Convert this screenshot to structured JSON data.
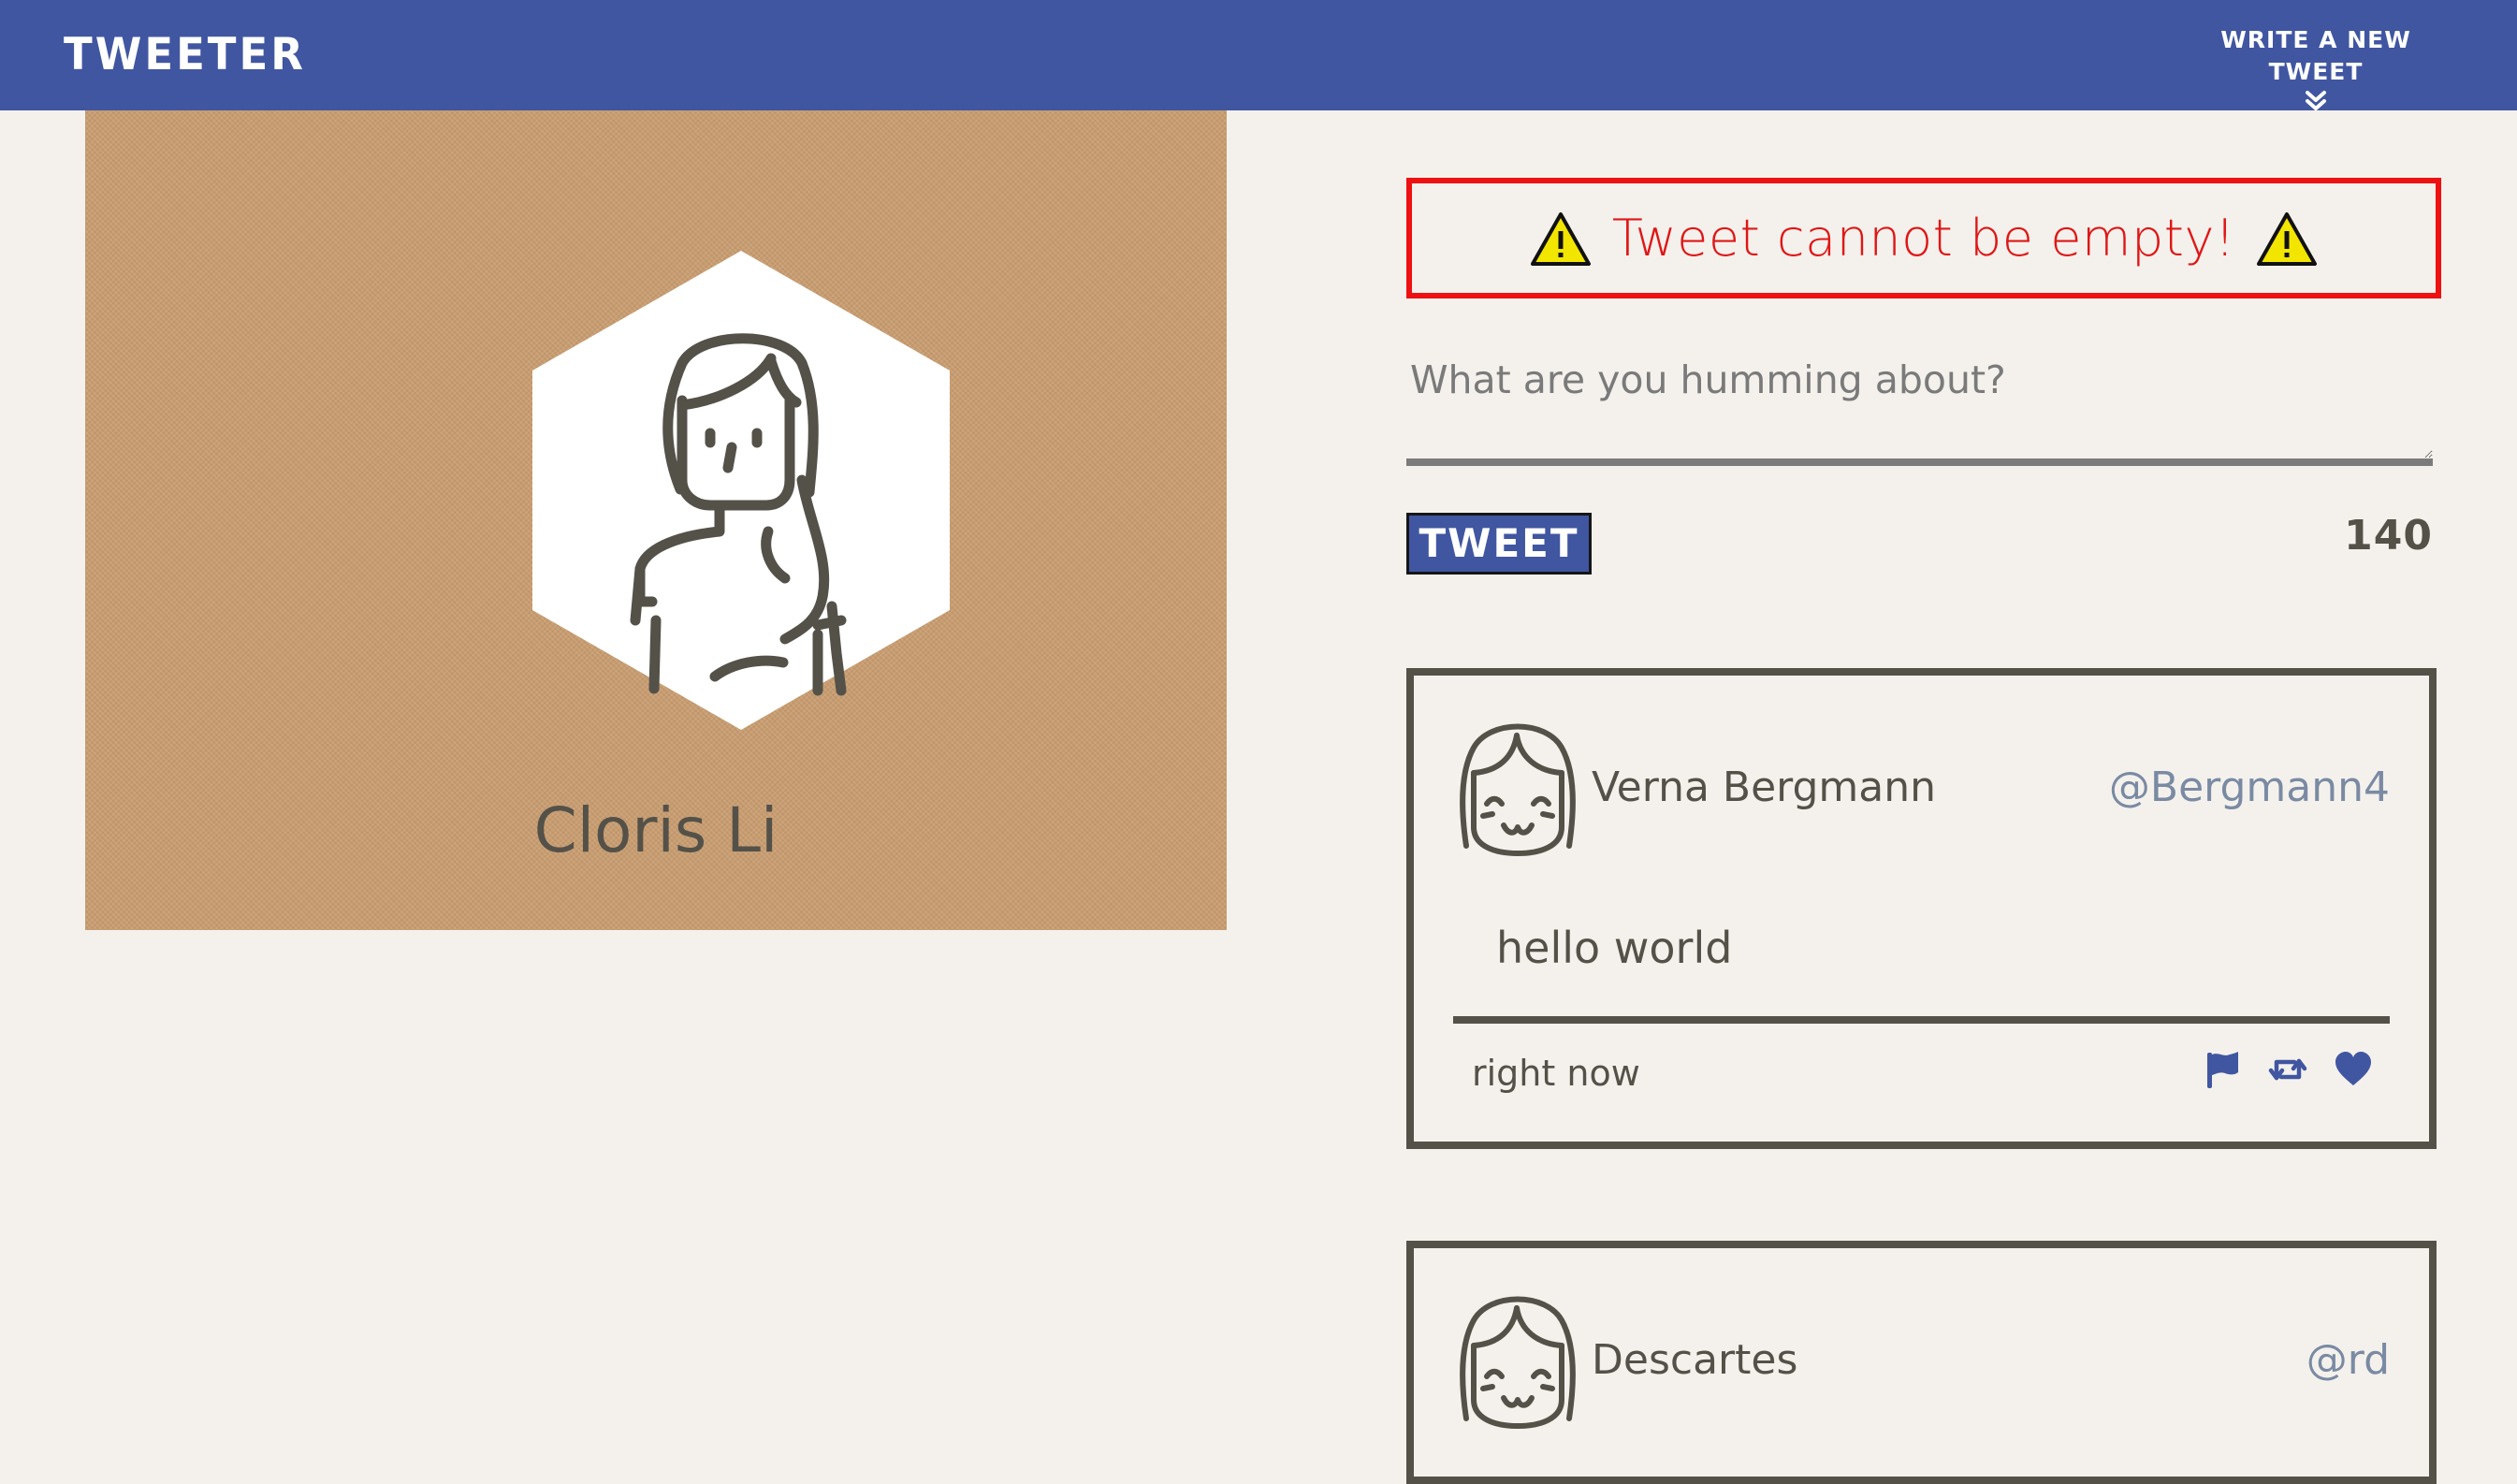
{
  "nav": {
    "title": "TWEETER",
    "write_label": "WRITE A NEW TWEET",
    "write_icon": "double-chevron-down-icon"
  },
  "profile": {
    "name": "Cloris Li",
    "avatar_icon": "woman-avatar-icon",
    "card_color": "#cb9f72"
  },
  "compose": {
    "error": {
      "text": "Tweet cannot be empty!",
      "icon": "warning-triangle-icon",
      "color": "#ee1111"
    },
    "placeholder": "What are you humming about?",
    "value": "",
    "tweet_button_label": "TWEET",
    "counter": "140"
  },
  "tweets": [
    {
      "author": "Verna Bergmann",
      "handle": "@Bergmann4",
      "body": "hello world",
      "time": "right now",
      "avatar_icon": "smiling-avatar-icon",
      "actions": [
        "flag-icon",
        "retweet-icon",
        "heart-icon"
      ]
    },
    {
      "author": "Descartes",
      "handle": "@rd",
      "avatar_icon": "smiling-avatar-icon"
    }
  ],
  "colors": {
    "accent": "#4056a1",
    "background": "#f4f1ec",
    "text": "#545149",
    "handle": "#7a8aa3"
  }
}
